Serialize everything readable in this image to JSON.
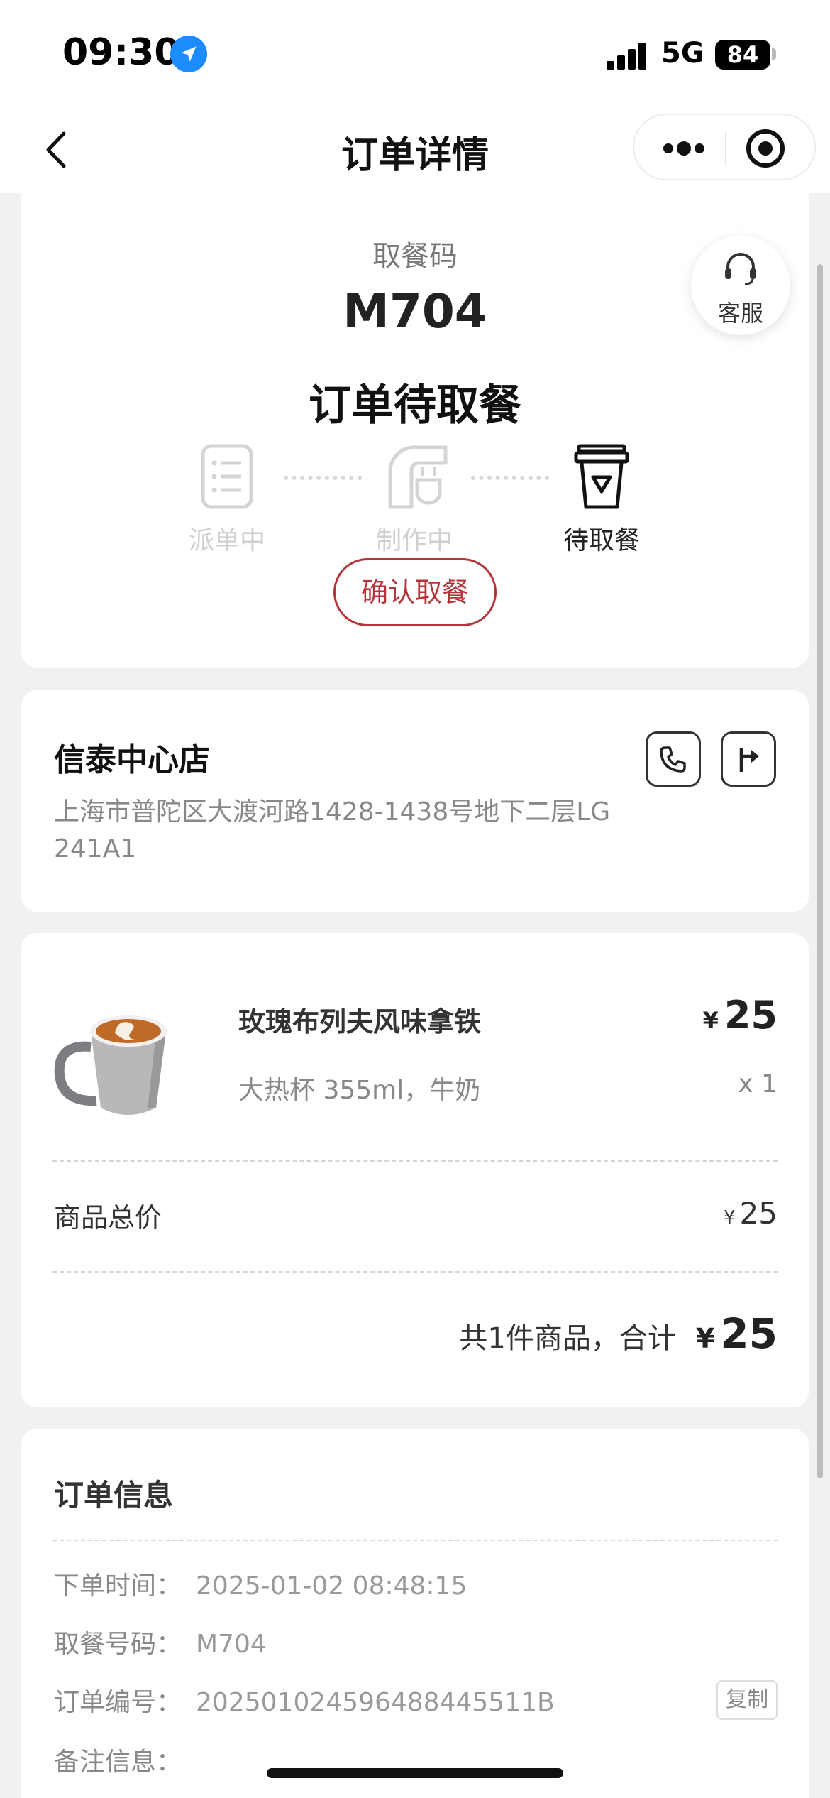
{
  "status_bar": {
    "time": "09:30",
    "network": "5G",
    "battery": "84",
    "battery_level": 0.84
  },
  "nav": {
    "title": "订单详情"
  },
  "order": {
    "pickup_label": "取餐码",
    "pickup_code": "M704",
    "status_title": "订单待取餐",
    "service_label": "客服",
    "steps": [
      {
        "label": "派单中",
        "state": "done"
      },
      {
        "label": "制作中",
        "state": "done"
      },
      {
        "label": "待取餐",
        "state": "active"
      }
    ],
    "confirm_label": "确认取餐"
  },
  "store": {
    "name": "信泰中心店",
    "address": "上海市普陀区大渡河路1428-1438号地下二层LG 241A1"
  },
  "items": [
    {
      "name": "玫瑰布列夫风味拿铁",
      "spec": "大热杯 355ml，牛奶",
      "currency": "¥",
      "price": "25",
      "qty": "x 1"
    }
  ],
  "summary": {
    "subtotal_label": "商品总价",
    "subtotal_currency": "¥",
    "subtotal_value": "25",
    "total_label": "共1件商品，合计",
    "total_currency": "¥",
    "total_value": "25"
  },
  "info": {
    "title": "订单信息",
    "rows": [
      {
        "label": "下单时间：",
        "value": "2025-01-02 08:48:15"
      },
      {
        "label": "取餐号码：",
        "value": "M704"
      },
      {
        "label": "订单编号：",
        "value": "20250102459648844551 1B"
      },
      {
        "label": "备注信息：",
        "value": ""
      }
    ],
    "copy_label": "复制"
  },
  "colors": {
    "accent": "#b5343a",
    "location_blue": "#1a8cff"
  },
  "icons": [
    "location-arrow-icon",
    "back-arrow-icon",
    "more-icon",
    "close-target-icon",
    "headset-icon",
    "dispatch-list-icon",
    "coffee-machine-icon",
    "pickup-cup-icon",
    "phone-icon",
    "navigation-icon",
    "latte-cup-image"
  ]
}
